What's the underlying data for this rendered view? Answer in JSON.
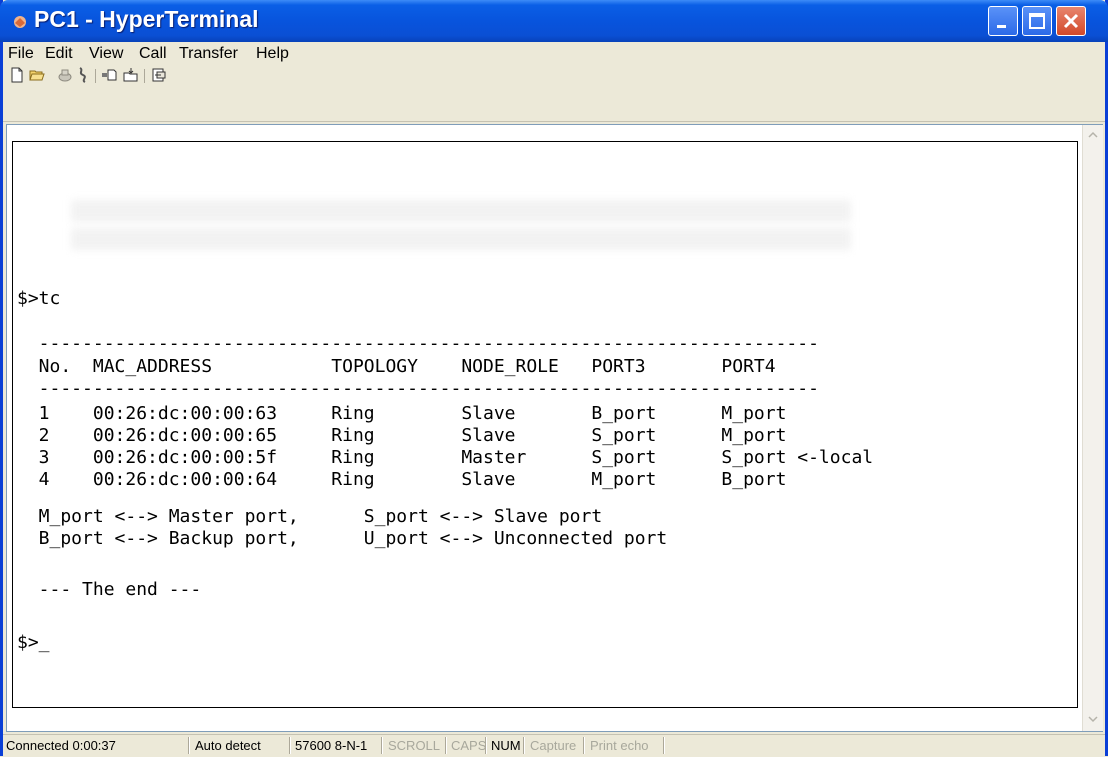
{
  "window": {
    "title": "PC1 - HyperTerminal",
    "colors": {
      "title_bar": "#0854dd",
      "close_button": "#d2492a",
      "background": "#ece9d8"
    }
  },
  "menu": {
    "items": [
      {
        "label": "File"
      },
      {
        "label": "Edit"
      },
      {
        "label": "View"
      },
      {
        "label": "Call"
      },
      {
        "label": "Transfer"
      },
      {
        "label": "Help"
      }
    ]
  },
  "toolbar": {
    "icons": [
      "new-icon",
      "open-icon",
      "connect-icon",
      "disconnect-icon",
      "send-icon",
      "receive-icon",
      "properties-icon"
    ]
  },
  "terminal": {
    "lines": [
      "$>tc",
      "  ------------------------------------------------------------------------",
      "  No.  MAC_ADDRESS           TOPOLOGY    NODE_ROLE   PORT3       PORT4",
      "  ------------------------------------------------------------------------",
      "  1    00:26:dc:00:00:63     Ring        Slave       B_port      M_port",
      "  2    00:26:dc:00:00:65     Ring        Slave       S_port      M_port",
      "  3    00:26:dc:00:00:5f     Ring        Master      S_port      S_port <-local",
      "  4    00:26:dc:00:00:64     Ring        Slave       M_port      B_port",
      "  M_port <--> Master port,      S_port <--> Slave port",
      "  B_port <--> Backup port,      U_port <--> Unconnected port",
      "  --- The end ---",
      "$>_"
    ]
  },
  "status": {
    "connected": "Connected 0:00:37",
    "detect": "Auto detect",
    "settings": "57600 8-N-1",
    "scroll": "SCROLL",
    "caps": "CAPS",
    "num": "NUM",
    "capture": "Capture",
    "print_echo": "Print echo"
  }
}
